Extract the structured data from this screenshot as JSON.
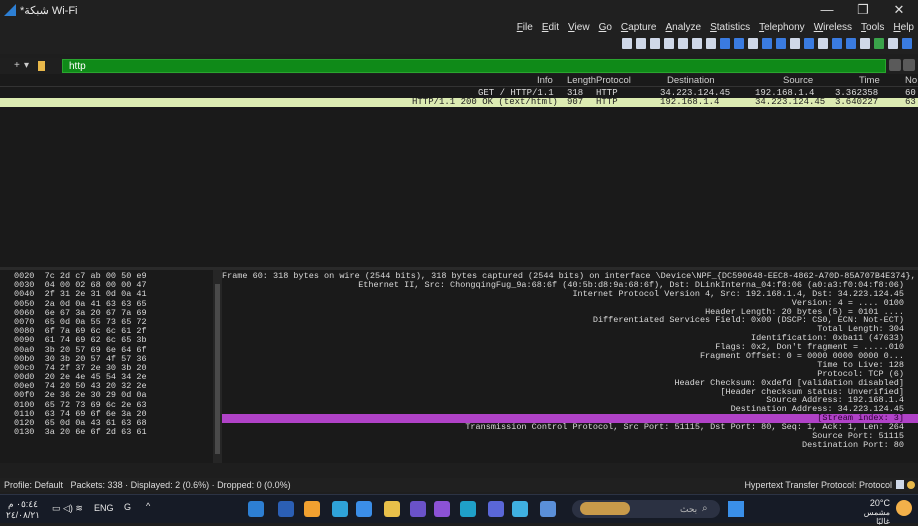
{
  "window": {
    "title": "*شبكة Wi-Fi"
  },
  "window_controls": {
    "minimize": "—",
    "restore": "❐",
    "close": "✕"
  },
  "menu": [
    "Help",
    "Tools",
    "Wireless",
    "Telephony",
    "Statistics",
    "Analyze",
    "Capture",
    "Go",
    "View",
    "Edit",
    "File"
  ],
  "toolbar_icons": [
    {
      "name": "layout-icon",
      "color": "#cfd8e8"
    },
    {
      "name": "resize-columns-icon",
      "color": "#cfd8e8"
    },
    {
      "name": "zoom-reset-icon",
      "color": "#cfd8e8"
    },
    {
      "name": "zoom-out-icon",
      "color": "#cfd8e8"
    },
    {
      "name": "zoom-in-icon",
      "color": "#cfd8e8"
    },
    {
      "name": "colorize-icon",
      "color": "#cfd8e8"
    },
    {
      "name": "autoscroll-icon",
      "color": "#cfd8e8"
    },
    {
      "name": "go-last-icon",
      "color": "#3a7be0"
    },
    {
      "name": "go-first-icon",
      "color": "#3a7be0"
    },
    {
      "name": "go-to-packet-icon",
      "color": "#cfd8e8"
    },
    {
      "name": "go-forward-icon",
      "color": "#3a7be0"
    },
    {
      "name": "go-back-icon",
      "color": "#3a7be0"
    },
    {
      "name": "find-packet-icon",
      "color": "#cfd8e8"
    },
    {
      "name": "reload-icon",
      "color": "#3a7be0"
    },
    {
      "name": "close-file-icon",
      "color": "#cfd8e8"
    },
    {
      "name": "save-file-icon",
      "color": "#3a7be0"
    },
    {
      "name": "open-file-icon",
      "color": "#3a7be0"
    },
    {
      "name": "options-icon",
      "color": "#cfd8e8"
    },
    {
      "name": "restart-capture-icon",
      "color": "#3aa34a"
    },
    {
      "name": "stop-capture-icon",
      "color": "#cfd8e8"
    },
    {
      "name": "start-capture-icon",
      "color": "#3a7be0"
    }
  ],
  "filter": {
    "value": "http",
    "add": "+",
    "dropdown": "▾"
  },
  "packet_list": {
    "columns": [
      "Info",
      "Length",
      "Protocol",
      "Destination",
      "Source",
      "Time",
      "No."
    ],
    "rows": [
      {
        "info": "GET / HTTP/1.1",
        "length": "318",
        "protocol": "HTTP",
        "destination": "34.223.124.45",
        "source": "192.168.1.4",
        "time": "3.362358",
        "no": "60",
        "selected": false
      },
      {
        "info": "HTTP/1.1 200 OK  (text/html)",
        "length": "907",
        "protocol": "HTTP",
        "destination": "192.168.1.4",
        "source": "34.223.124.45",
        "time": "3.640227",
        "no": "63",
        "selected": true
      }
    ]
  },
  "hex_lines": [
    "0020  7c 2d c7 ab 00 50 e9",
    "0030  04 00 02 68 00 00 47",
    "0040  2f 31 2e 31 0d 0a 41",
    "0050  2a 0d 0a 41 63 63 65",
    "0060  6e 67 3a 20 67 7a 69",
    "0070  65 0d 0a 55 73 65 72",
    "0080  6f 7a 69 6c 6c 61 2f",
    "0090  61 74 69 62 6c 65 3b",
    "00a0  3b 20 57 69 6e 64 6f",
    "00b0  30 3b 20 57 4f 57 36",
    "00c0  74 2f 37 2e 30 3b 20",
    "00d0  20 2e 4e 45 54 34 2e",
    "00e0  74 20 50 43 20 32 2e",
    "00f0  2e 36 2e 30 29 0d 0a",
    "0100  65 72 73 69 6c 2e 63",
    "0110  63 74 69 6f 6e 3a 20",
    "0120  65 0d 0a 43 61 63 68",
    "0130  3a 20 6e 6f 2d 63 61"
  ],
  "detail_lines": [
    {
      "text": "Frame 60: 318 bytes on wire (2544 bits), 318 bytes captured (2544 bits) on interface \\Device\\NPF_{DC590648-EEC8-4862-A70D-85A707B4E374}, id 0",
      "hl": false
    },
    {
      "text": "Ethernet II, Src: ChongqingFug_9a:68:6f (40:5b:d8:9a:68:6f), Dst: DLinkInterna_04:f8:06 (a0:a3:f0:04:f8:06)",
      "hl": false
    },
    {
      "text": "Internet Protocol Version 4, Src: 192.168.1.4, Dst: 34.223.124.45",
      "hl": false
    },
    {
      "text": "Version: 4 = .... 0100",
      "hl": false
    },
    {
      "text": "Header Length: 20 bytes (5) = 0101 ....",
      "hl": false
    },
    {
      "text": "Differentiated Services Field: 0x00 (DSCP: CS0, ECN: Not-ECT)",
      "hl": false
    },
    {
      "text": "Total Length: 304",
      "hl": false
    },
    {
      "text": "Identification: 0xba11 (47633)",
      "hl": false
    },
    {
      "text": "Flags: 0x2, Don't fragment = .....010",
      "hl": false
    },
    {
      "text": "Fragment Offset: 0 = 0000 0000 0000 0...",
      "hl": false
    },
    {
      "text": "Time to Live: 128",
      "hl": false
    },
    {
      "text": "Protocol: TCP (6)",
      "hl": false
    },
    {
      "text": "Header Checksum: 0xdefd [validation disabled]",
      "hl": false
    },
    {
      "text": "[Header checksum status: Unverified]",
      "hl": false
    },
    {
      "text": "Source Address: 192.168.1.4",
      "hl": false
    },
    {
      "text": "Destination Address: 34.223.124.45",
      "hl": false
    },
    {
      "text": "[Stream index: 3]",
      "hl": true
    },
    {
      "text": "Transmission Control Protocol, Src Port: 51115, Dst Port: 80, Seq: 1, Ack: 1, Len: 264",
      "hl": false
    },
    {
      "text": "Source Port: 51115",
      "hl": false
    },
    {
      "text": "Destination Port: 80",
      "hl": false
    }
  ],
  "status": {
    "profile": "Profile: Default",
    "packets": "Packets: 338 · Displayed: 2 (0.6%) · Dropped: 0 (0.0%)",
    "protocol": "Hypertext Transfer Protocol: Protocol"
  },
  "taskbar": {
    "time": "٠٥:٤٤ م",
    "date": "٢٤/٠٨/٢١",
    "lang": "ENG",
    "search_placeholder": "بحث",
    "weather_temp": "20°C",
    "weather_desc": "مشمس غالبًا",
    "apps": [
      {
        "name": "wireshark-taskbar-icon",
        "color": "#2d7fd3"
      },
      {
        "name": "word-taskbar-icon",
        "color": "#2b5fb5"
      },
      {
        "name": "paint-taskbar-icon",
        "color": "#f0a030"
      },
      {
        "name": "app-taskbar-icon",
        "color": "#2fa3d8"
      },
      {
        "name": "chrome-taskbar-icon",
        "color": "#3b8ee8"
      },
      {
        "name": "files-taskbar-icon",
        "color": "#e8c04a"
      },
      {
        "name": "store-taskbar-icon",
        "color": "#6a52c9"
      },
      {
        "name": "vs-taskbar-icon",
        "color": "#8c52d6"
      },
      {
        "name": "edge-taskbar-icon",
        "color": "#1fa0c8"
      },
      {
        "name": "teams-taskbar-icon",
        "color": "#5a67d8"
      },
      {
        "name": "photos-taskbar-icon",
        "color": "#3fb0e0"
      },
      {
        "name": "explorer-taskbar-icon",
        "color": "#5a8fd8"
      }
    ]
  }
}
